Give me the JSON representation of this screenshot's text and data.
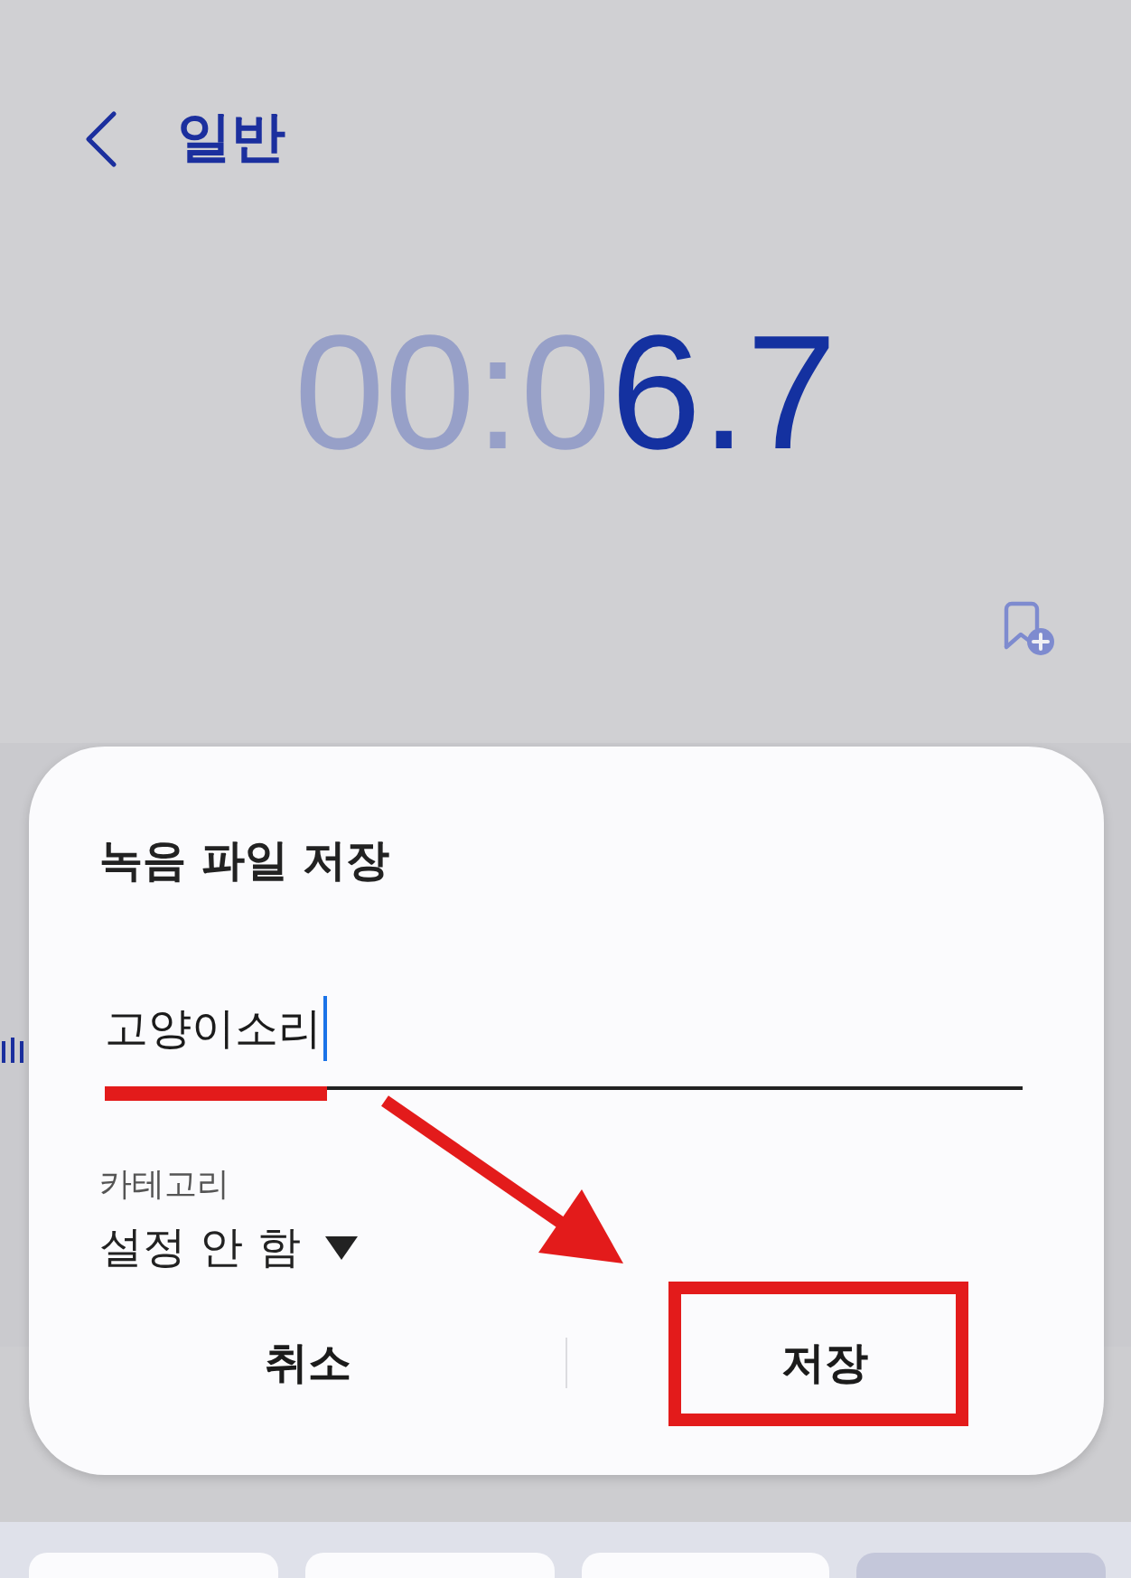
{
  "header": {
    "title": "일반"
  },
  "timer": {
    "segments": [
      {
        "text": "00:0",
        "active": false
      },
      {
        "text": "6.7",
        "active": true
      }
    ]
  },
  "dialog": {
    "title": "녹음 파일 저장",
    "name_field": {
      "value": "고양이소리",
      "focused": true
    },
    "category": {
      "label": "카테고리",
      "value": "설정 안 함"
    },
    "buttons": [
      {
        "label": "취소"
      },
      {
        "label": "저장"
      }
    ]
  },
  "annotations": [
    {
      "kind": "underline"
    },
    {
      "kind": "arrow"
    },
    {
      "kind": "frame"
    }
  ],
  "keyboard": {
    "keys": [
      {
        "kind": "digit"
      },
      {
        "kind": "digit"
      },
      {
        "kind": "digit"
      },
      {
        "kind": "action"
      }
    ]
  }
}
